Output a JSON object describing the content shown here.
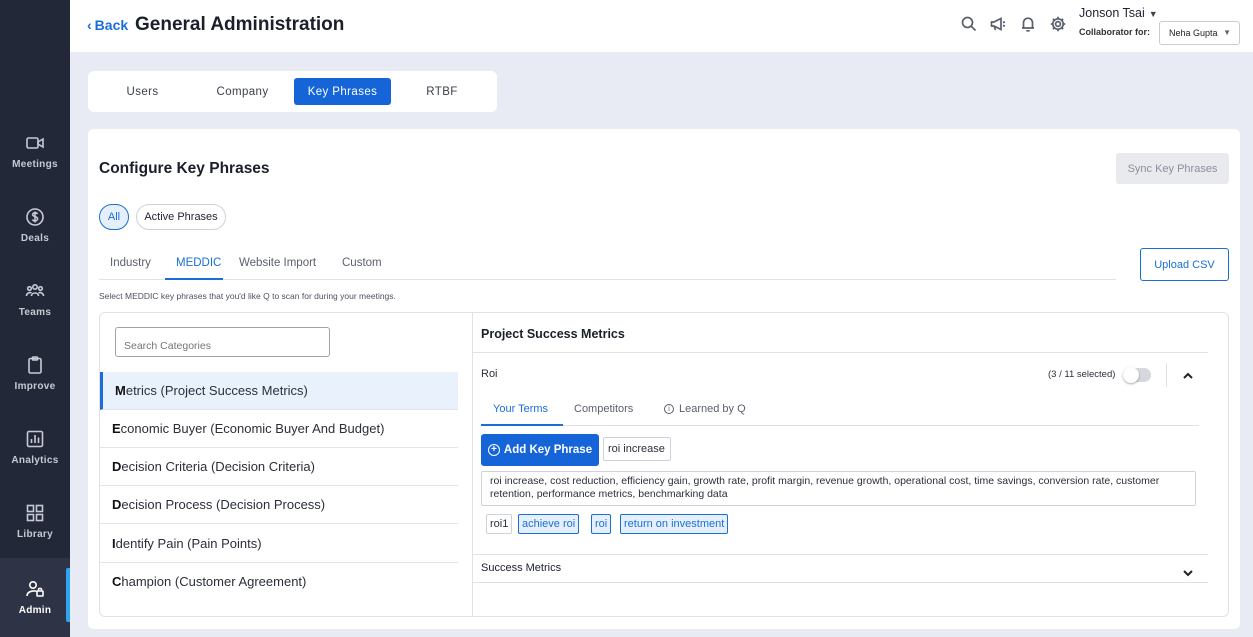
{
  "sidebar": {
    "items": [
      {
        "label": "Meetings",
        "icon": "video-camera-icon"
      },
      {
        "label": "Deals",
        "icon": "dollar-icon"
      },
      {
        "label": "Teams",
        "icon": "team-icon"
      },
      {
        "label": "Improve",
        "icon": "clipboard-icon"
      },
      {
        "label": "Analytics",
        "icon": "bar-chart-icon"
      },
      {
        "label": "Library",
        "icon": "grid-icon"
      },
      {
        "label": "Admin",
        "icon": "admin-user-icon"
      }
    ],
    "active": "Admin"
  },
  "header": {
    "back_label": "Back",
    "title": "General Administration",
    "user_name": "Jonson Tsai",
    "collaborator_label": "Collaborator for:",
    "collaborator_value": "Neha Gupta"
  },
  "top_tabs": {
    "items": [
      "Users",
      "Company",
      "Key Phrases",
      "RTBF"
    ],
    "active": "Key Phrases"
  },
  "configure": {
    "title": "Configure Key Phrases",
    "sync_label": "Sync Key Phrases",
    "filters": [
      "All",
      "Active Phrases"
    ],
    "active_filter": "All",
    "sub_tabs": [
      "Industry",
      "MEDDIC",
      "Website Import",
      "Custom"
    ],
    "active_sub_tab": "MEDDIC",
    "upload_label": "Upload CSV",
    "help_text": "Select MEDDIC key phrases that you'd like Q to scan for during your meetings."
  },
  "categories": {
    "search_placeholder": "Search Categories",
    "items": [
      {
        "first": "M",
        "rest": "etrics (Project Success Metrics)"
      },
      {
        "first": "E",
        "rest": "conomic Buyer (Economic Buyer And Budget)"
      },
      {
        "first": "D",
        "rest": "ecision Criteria (Decision Criteria)"
      },
      {
        "first": "D",
        "rest": "ecision Process (Decision Process)"
      },
      {
        "first": "I",
        "rest": "dentify Pain (Pain Points)"
      },
      {
        "first": "C",
        "rest": "hampion (Customer Agreement)"
      }
    ],
    "active_index": 0
  },
  "detail": {
    "title": "Project Success Metrics",
    "group": {
      "name": "Roi",
      "selected_count": "(3 / 11 selected)",
      "toggle_on": false,
      "tabs": [
        "Your Terms",
        "Competitors",
        "Learned by Q"
      ],
      "active_tab": "Your Terms",
      "add_label": "Add Key Phrase",
      "phrase_input_value": "roi increase",
      "terms": "roi increase, cost reduction, efficiency gain, growth rate, profit margin, revenue growth, operational cost, time savings, conversion rate, customer retention, performance metrics, benchmarking data",
      "tags": [
        {
          "label": "roi1",
          "selected": false
        },
        {
          "label": "achieve roi",
          "selected": true
        },
        {
          "label": "roi",
          "selected": true
        },
        {
          "label": "return on investment",
          "selected": true
        }
      ]
    },
    "second_group": "Success Metrics"
  },
  "colors": {
    "accent": "#1565d8",
    "sidebar_bg": "#232838",
    "page_bg": "#e9ebf4"
  }
}
